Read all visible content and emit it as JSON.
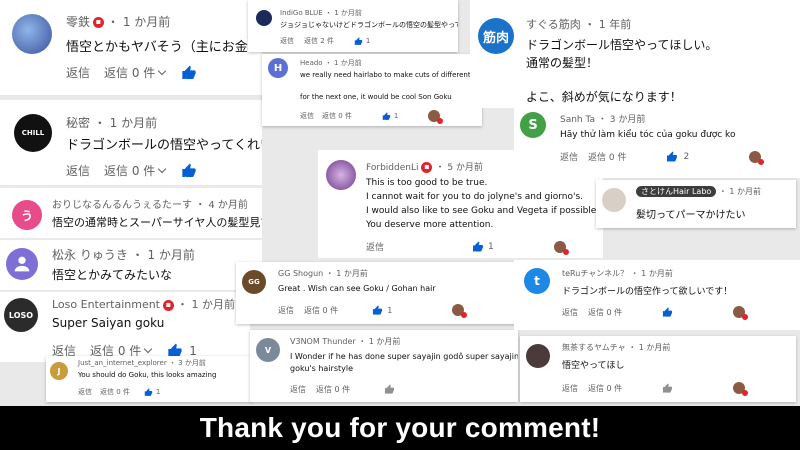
{
  "ui": {
    "reply": "返信",
    "replies": "返信 0 件",
    "replies_small": "返信 2 件"
  },
  "comments": {
    "c1": {
      "author": "零鉄",
      "time": "・ 1 か月前",
      "text": "悟空とかもヤバそう（主にお金が）"
    },
    "c2": {
      "author": "秘密",
      "time": "・ 1 か月前",
      "text": "ドラゴンボールの悟空やってくれい(👍￣▽￣)👍"
    },
    "c3": {
      "author": "おりじなるんるんうぇるたーす",
      "time": "・ 4 か月前",
      "text": "悟空の通常時とスーパーサイヤ人の髪型見てみたいです。"
    },
    "c4": {
      "author": "松永 りゅうき",
      "time": "・ 1 か月前",
      "text": "悟空とかみてみたいな"
    },
    "c5": {
      "author": "Loso Entertainment",
      "time": "・ 1 か月前",
      "text": "Super Saiyan goku",
      "likes": "1"
    },
    "c6": {
      "author": "Just_an_internet_explorer",
      "time": "・ 3 か月前",
      "text": "You should do Goku, this looks amazing",
      "likes": "1"
    },
    "c7": {
      "author": "IndiGo BLUE",
      "time": "・ 1 か月前",
      "text": "ジョジョじゃないけどドラゴンボールの悟空の髪型やって欲しい",
      "likes": "1"
    },
    "c8": {
      "author": "Heado",
      "time": "・ 1 か月前",
      "line1": "we really need hairlabo to make cuts of different anime",
      "line2": "for the next one, it would be cool Son Goku",
      "likes": "1"
    },
    "c9": {
      "author": "ForbiddenLi",
      "time": "・ 5 か月前",
      "line1": "This is too good to be true.",
      "line2": "I cannot wait for you to do jolyne's and giorno's.",
      "line3": "I would also like to see Goku and Vegeta if possible.",
      "line4": "You deserve more attention.",
      "likes": "1"
    },
    "c10": {
      "author": "GG Shogun",
      "time": "・ 1 か月前",
      "text": "Great . Wish can see Goku / Gohan  hair",
      "likes": "1"
    },
    "c11": {
      "author": "V3NOM Thunder",
      "time": "・ 1 か月前",
      "line1": "I Wonder if he has done super sayajin godô super sayajin",
      "line2": "goku's hairstyle"
    },
    "c12": {
      "author": "すぐる筋肉",
      "time": "・ 1 年前",
      "avatar": "筋肉",
      "line1": "ドラゴンボール悟空やってほしい。",
      "line2": "通常の髪型！",
      "line3": "よこ、斜めが気になります！"
    },
    "c13": {
      "author": "Sanh Ta",
      "time": "・ 3 か月前",
      "avatar": "S",
      "text": "Hãy thử làm kiểu tóc của goku được ko",
      "likes": "2"
    },
    "c14": {
      "author": "さとけん",
      "author_tag": "Hair Labo",
      "time": "・ 1 か月前",
      "text": "髪切ってパーマかけたい"
    },
    "c15": {
      "author": "teRuチャンネル？",
      "time": "・ 1 か月前",
      "avatar": "t",
      "text": "ドラゴンボールの悟空作って欲しいです！"
    },
    "c16": {
      "author": "無茶するヤムチャ",
      "time": "・ 1 か月前",
      "text": "悟空やってほし"
    }
  },
  "banner": "Thank you for your comment!",
  "colors": {
    "accent": "#065fd4",
    "badge": "#e0242b",
    "sanh": "#43a047",
    "teru": "#1e88e5",
    "suguru": "#1a73c9"
  }
}
